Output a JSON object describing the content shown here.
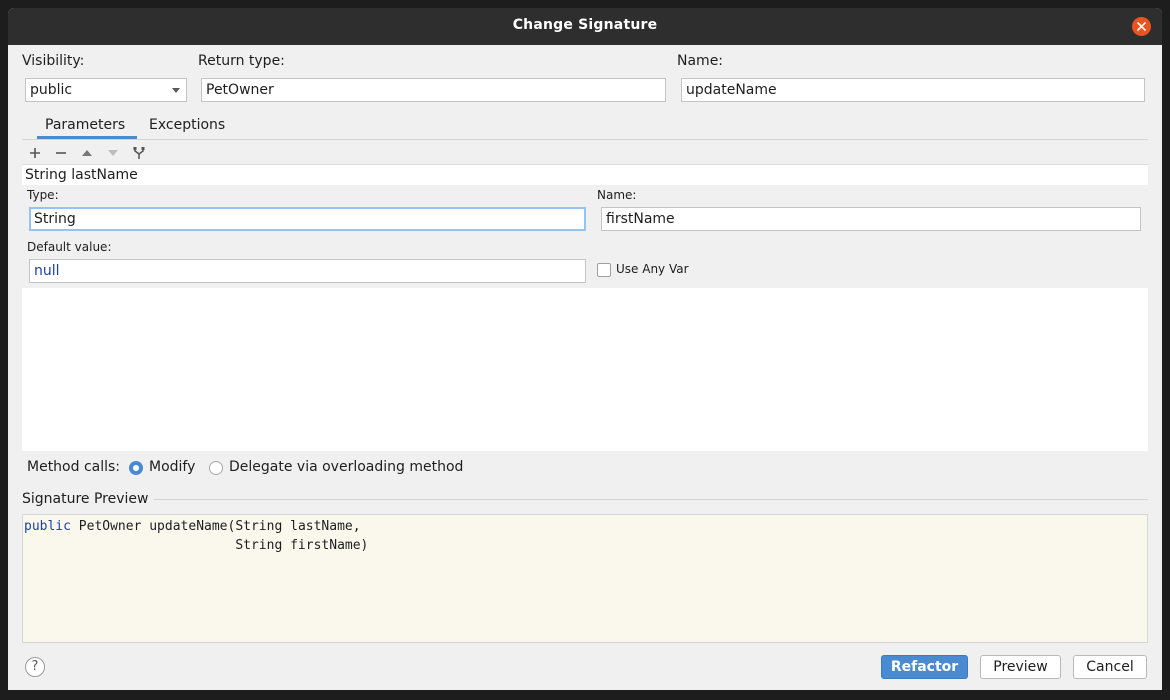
{
  "window": {
    "title": "Change Signature"
  },
  "top": {
    "visibility_label": "Visibility:",
    "visibility_value": "public",
    "return_type_label": "Return type:",
    "return_type_value": "PetOwner",
    "name_label": "Name:",
    "name_value": "updateName"
  },
  "tabs": [
    {
      "label": "Parameters",
      "selected": true
    },
    {
      "label": "Exceptions",
      "selected": false
    }
  ],
  "toolbar": {
    "icons": [
      "add-icon",
      "remove-icon",
      "move-up-icon",
      "move-down-icon",
      "propagate-icon"
    ]
  },
  "params": {
    "list": [
      "String lastName"
    ],
    "type_label": "Type:",
    "type_value": "String",
    "name_label": "Name:",
    "name_value": "firstName",
    "default_label": "Default value:",
    "default_value": "null",
    "use_any_var": "Use Any Var",
    "use_any_var_checked": false
  },
  "method_calls": {
    "label": "Method calls:",
    "options": [
      {
        "label": "Modify",
        "selected": true
      },
      {
        "label": "Delegate via overloading method",
        "selected": false
      }
    ]
  },
  "preview": {
    "title": "Signature Preview",
    "line1_keyword": "public",
    "line1_rest": " PetOwner updateName(String lastName,",
    "line2": "                           String firstName)"
  },
  "footer": {
    "help": "?",
    "refactor": "Refactor",
    "preview": "Preview",
    "cancel": "Cancel"
  },
  "colors": {
    "accent": "#4a8ad0",
    "close": "#e95420",
    "titlebar": "#2e2e2e",
    "preview_bg": "#faf8ec",
    "keyword": "#1f3fa8"
  }
}
